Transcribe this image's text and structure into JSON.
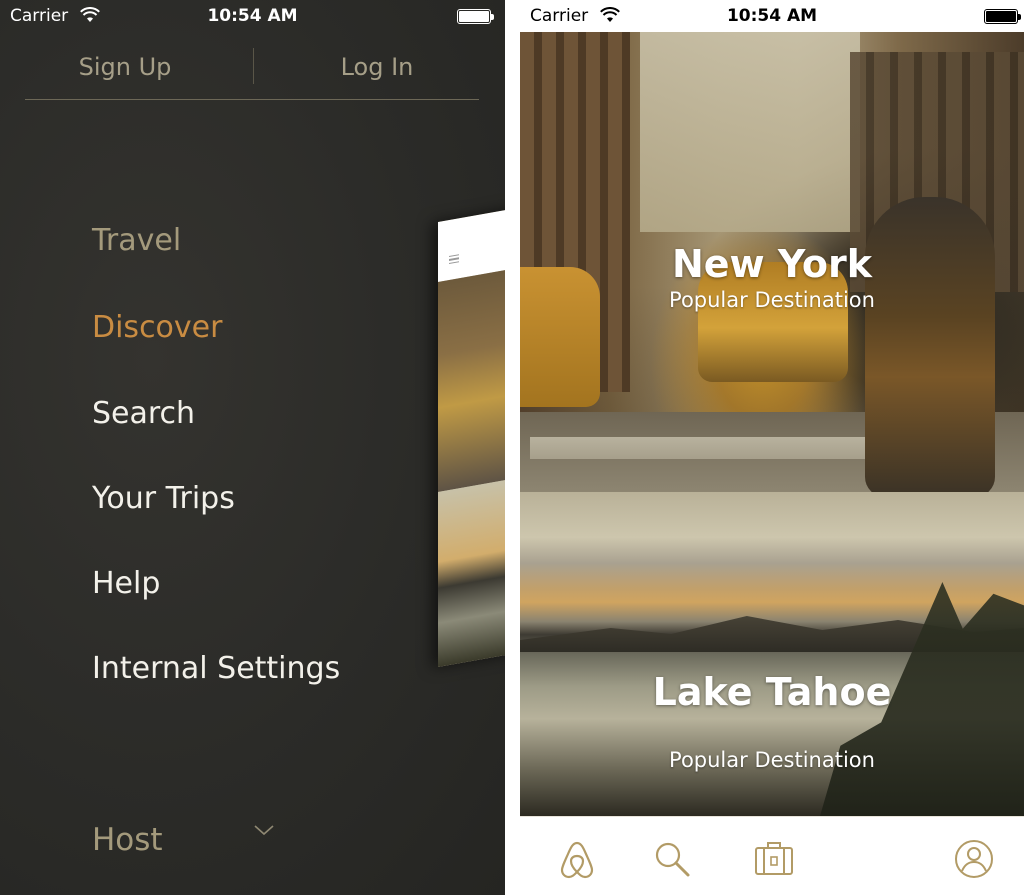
{
  "left_screen": {
    "status_bar": {
      "carrier": "Carrier",
      "time": "10:54 AM"
    },
    "auth": {
      "sign_up": "Sign Up",
      "log_in": "Log In"
    },
    "menu": {
      "heading": "Travel",
      "items": [
        {
          "label": "Discover",
          "state": "active"
        },
        {
          "label": "Search"
        },
        {
          "label": "Your Trips"
        },
        {
          "label": "Help"
        },
        {
          "label": "Internal Settings"
        }
      ],
      "footer_section": "Host"
    }
  },
  "right_screen": {
    "status_bar": {
      "carrier": "Carrier",
      "time": "10:54 AM"
    },
    "destinations": [
      {
        "name": "New York",
        "subtitle": "Popular Destination"
      },
      {
        "name": "Lake Tahoe",
        "subtitle": "Popular Destination"
      }
    ],
    "tab_bar": [
      {
        "icon": "airbnb-logo-icon",
        "state": "active"
      },
      {
        "icon": "search-icon"
      },
      {
        "icon": "suitcase-icon"
      },
      {
        "icon": "profile-icon"
      }
    ]
  },
  "colors": {
    "accent": "#c98c42",
    "menu_heading": "#a49a7c",
    "menu_background": "#2b2b28",
    "tab_icon": "#b29b66"
  }
}
